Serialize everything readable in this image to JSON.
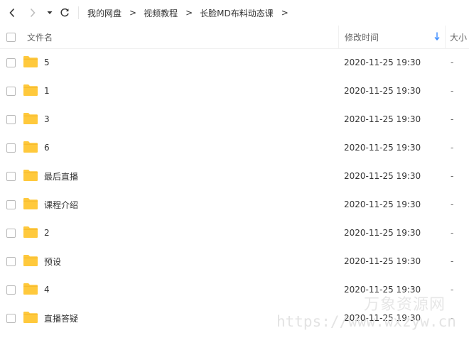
{
  "breadcrumb": [
    "我的网盘",
    "视频教程",
    "长脸MD布料动态课"
  ],
  "breadcrumb_sep": ">",
  "header": {
    "name": "文件名",
    "mtime": "修改时间",
    "size": "大小"
  },
  "rows": [
    {
      "name": "5",
      "mtime": "2020-11-25 19:30",
      "size": "-"
    },
    {
      "name": "1",
      "mtime": "2020-11-25 19:30",
      "size": "-"
    },
    {
      "name": "3",
      "mtime": "2020-11-25 19:30",
      "size": "-"
    },
    {
      "name": "6",
      "mtime": "2020-11-25 19:30",
      "size": "-"
    },
    {
      "name": "最后直播",
      "mtime": "2020-11-25 19:30",
      "size": "-"
    },
    {
      "name": "课程介绍",
      "mtime": "2020-11-25 19:30",
      "size": "-"
    },
    {
      "name": "2",
      "mtime": "2020-11-25 19:30",
      "size": "-"
    },
    {
      "name": "预设",
      "mtime": "2020-11-25 19:30",
      "size": "-"
    },
    {
      "name": "4",
      "mtime": "2020-11-25 19:30",
      "size": "-"
    },
    {
      "name": "直播答疑",
      "mtime": "2020-11-25 19:30",
      "size": "-"
    }
  ],
  "watermark": {
    "title": "万象资源网",
    "url": "https://www.wxzyw.cn"
  },
  "colors": {
    "folder": "#ffc93c",
    "sort_arrow": "#3b8cff"
  }
}
